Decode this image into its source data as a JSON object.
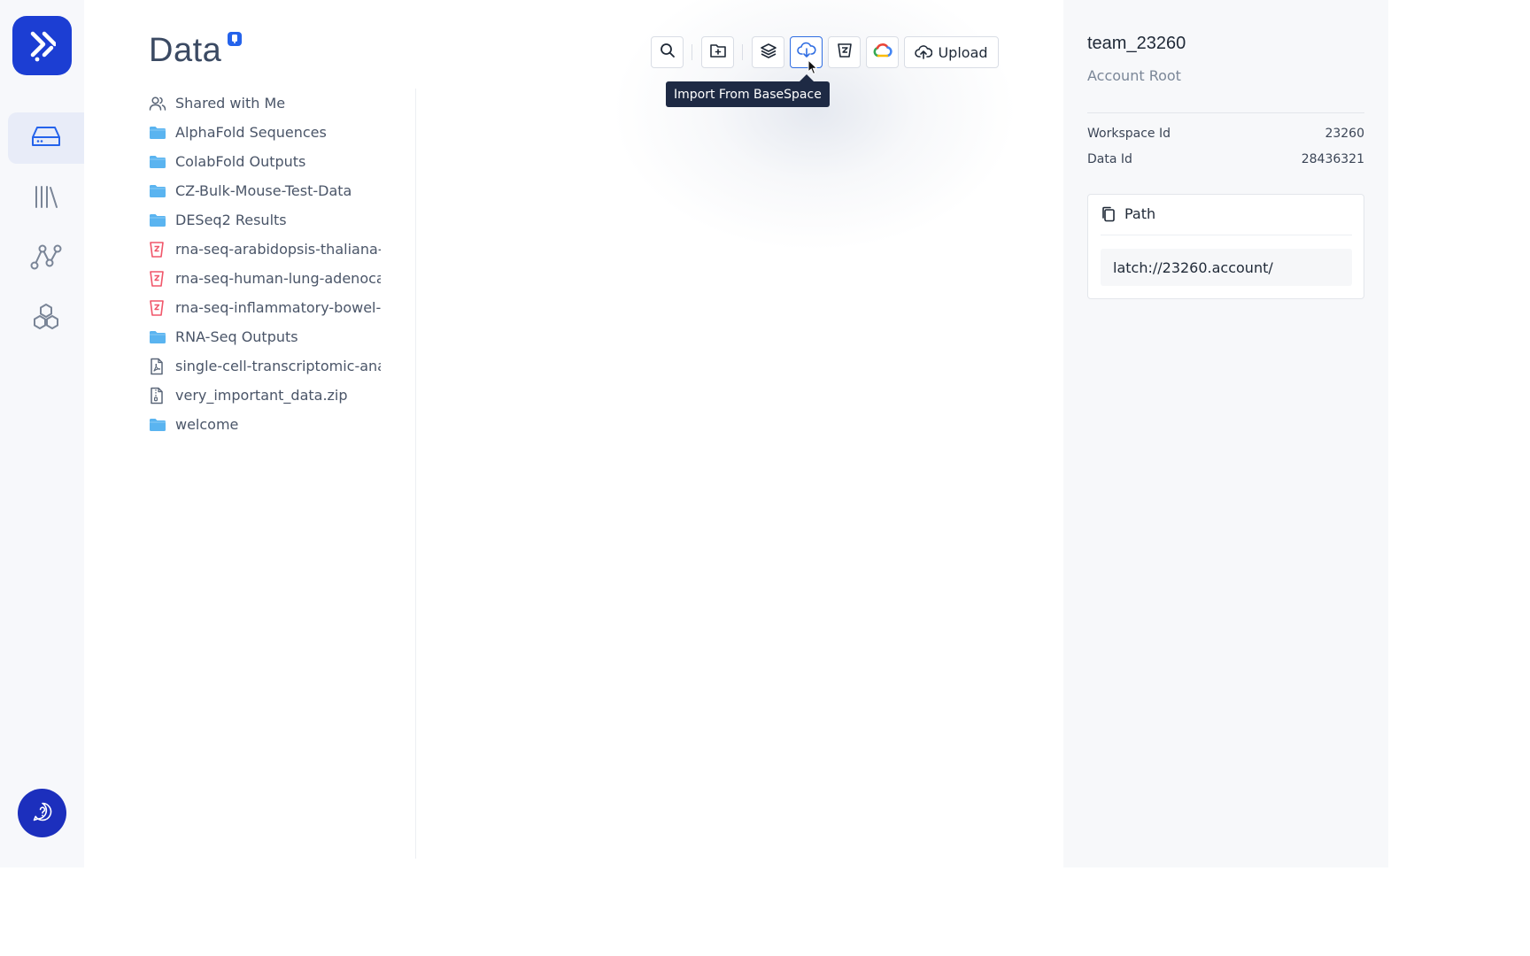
{
  "nav": {
    "logo_icon": "latch-logo-icon",
    "items": [
      {
        "name": "data",
        "icon": "drive-icon",
        "active": true
      },
      {
        "name": "registry",
        "icon": "library-icon",
        "active": false
      },
      {
        "name": "workflows",
        "icon": "graph-icon",
        "active": false
      },
      {
        "name": "molecules",
        "icon": "hexagons-icon",
        "active": false
      }
    ],
    "help_icon": "help-chat-icon"
  },
  "main": {
    "title": "Data",
    "files": [
      {
        "label": "Shared with Me",
        "icon": "users-icon"
      },
      {
        "label": "AlphaFold Sequences",
        "icon": "folder-icon"
      },
      {
        "label": "ColabFold Outputs",
        "icon": "folder-icon"
      },
      {
        "label": "CZ-Bulk-Mouse-Test-Data",
        "icon": "folder-icon"
      },
      {
        "label": "DESeq2 Results",
        "icon": "folder-icon"
      },
      {
        "label": "rna-seq-arabidopsis-thaliana-r",
        "icon": "bucket-icon"
      },
      {
        "label": "rna-seq-human-lung-adenoca",
        "icon": "bucket-icon"
      },
      {
        "label": "rna-seq-inflammatory-bowel-c",
        "icon": "bucket-icon"
      },
      {
        "label": "RNA-Seq Outputs",
        "icon": "folder-icon"
      },
      {
        "label": "single-cell-transcriptomic-anal",
        "icon": "pdf-file-icon"
      },
      {
        "label": "very_important_data.zip",
        "icon": "zip-file-icon"
      },
      {
        "label": "welcome",
        "icon": "folder-icon"
      }
    ]
  },
  "toolbar": {
    "upload_label": "Upload",
    "tooltip": "Import From BaseSpace",
    "buttons": [
      "search-icon",
      "new-folder-icon",
      "layers-icon",
      "cloud-import-icon",
      "s3-bucket-icon",
      "google-cloud-icon"
    ]
  },
  "info": {
    "name": "team_23260",
    "subtitle": "Account Root",
    "workspace_label": "Workspace Id",
    "workspace_value": "23260",
    "data_label": "Data Id",
    "data_value": "28436321",
    "path_label": "Path",
    "path_value": "latch://23260.account/"
  },
  "colors": {
    "brand": "#1c3ed3",
    "folder": "#5ab4f0",
    "bucket": "#f0566a",
    "tooltip_bg": "#1e2a44",
    "active_border": "#2f6de2"
  }
}
